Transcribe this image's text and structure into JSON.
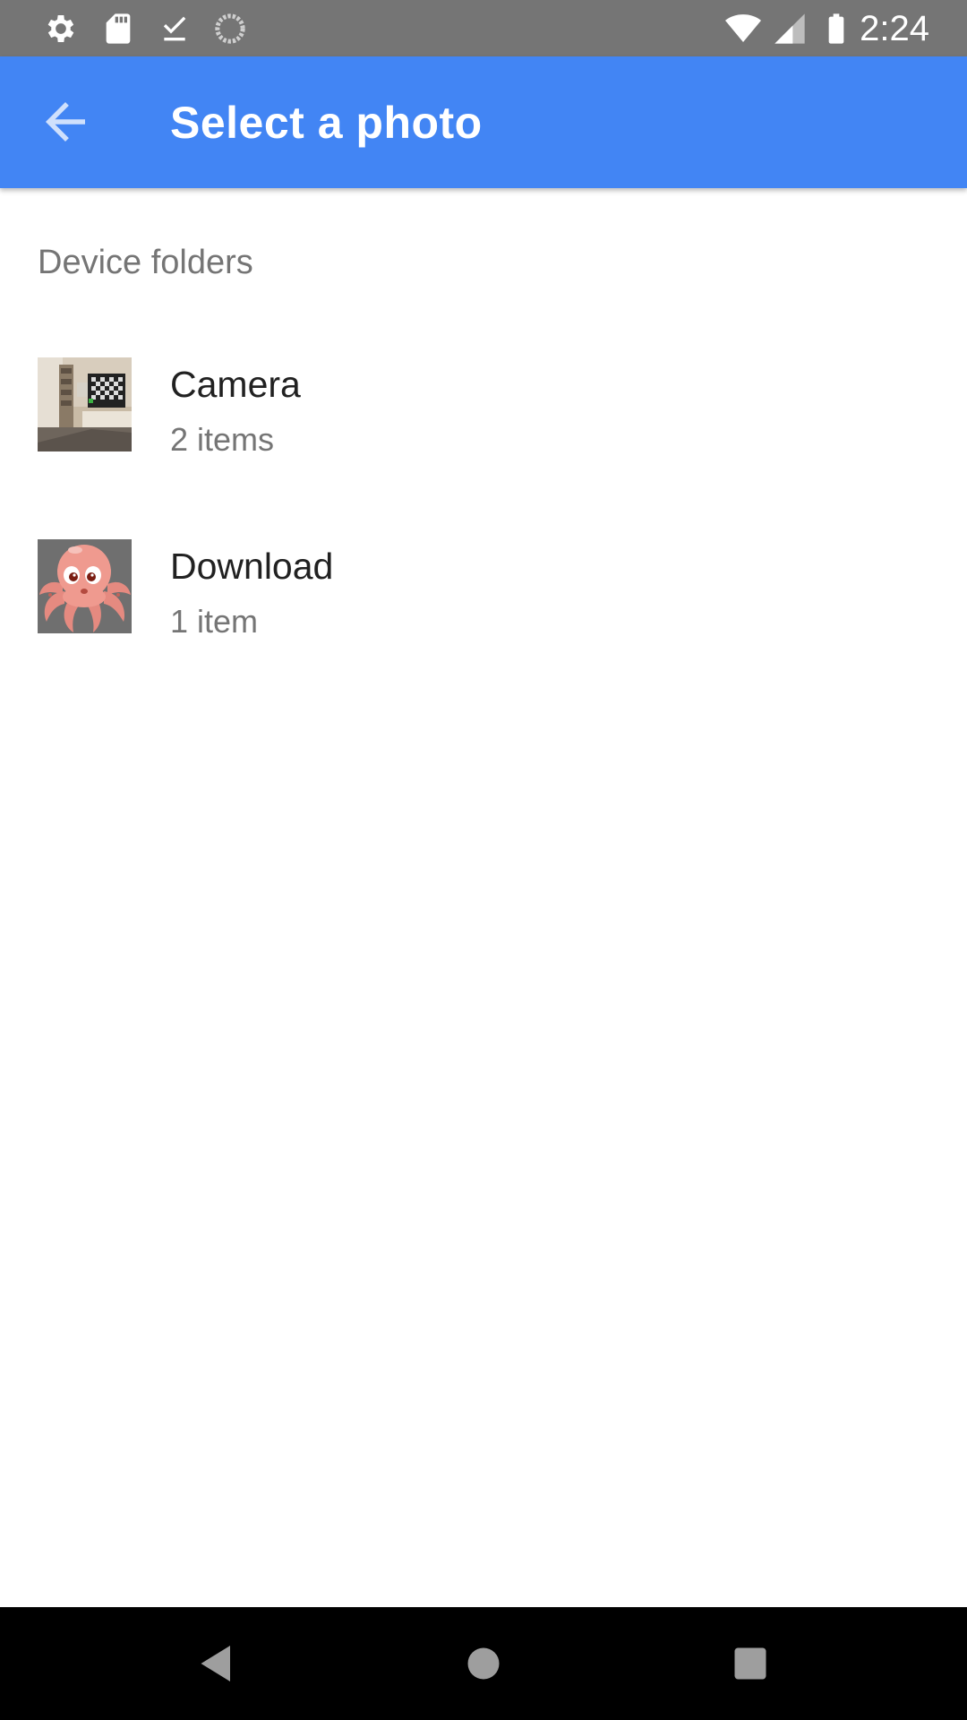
{
  "status_bar": {
    "time": "2:24",
    "icons": [
      "settings-icon",
      "sd-card-icon",
      "download-done-icon",
      "sync-icon",
      "wifi-icon",
      "signal-icon",
      "battery-icon"
    ]
  },
  "app_bar": {
    "title": "Select a photo",
    "back_icon": "arrow-back-icon",
    "color": "#4285f4"
  },
  "content": {
    "section_header": "Device folders",
    "folders": [
      {
        "name": "Camera",
        "count": "2 items",
        "thumb": "room-photo-thumbnail"
      },
      {
        "name": "Download",
        "count": "1 item",
        "thumb": "octopus-image-thumbnail"
      }
    ]
  },
  "nav_bar": {
    "buttons": [
      "back-nav-icon",
      "home-nav-icon",
      "recents-nav-icon"
    ]
  }
}
